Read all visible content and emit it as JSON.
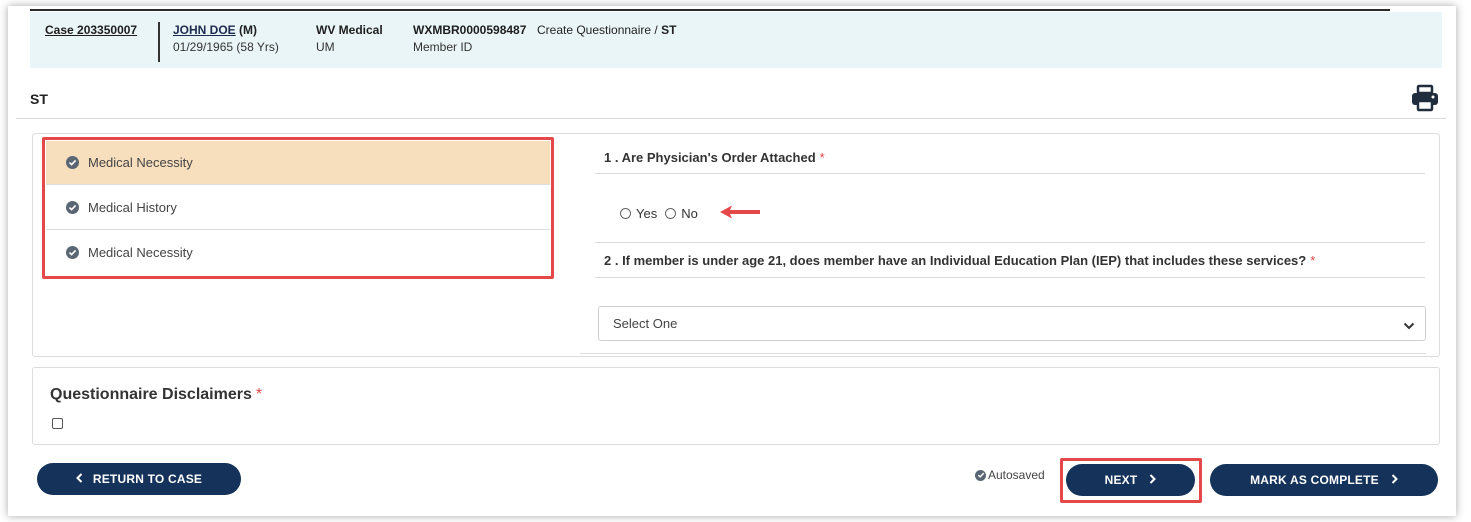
{
  "header": {
    "case_link": "Case 203350007",
    "member_name": "JOHN DOE",
    "member_gender": "(M)",
    "member_dob": "01/29/1965 (58 Yrs)",
    "plan_name": "WV Medical",
    "plan_type": "UM",
    "member_id": "WXMBR0000598487",
    "member_id_label": "Member ID",
    "breadcrumb_prefix": "Create Questionnaire /",
    "breadcrumb_current": "ST"
  },
  "page": {
    "title": "ST",
    "print_icon": "printer-icon"
  },
  "sections": [
    {
      "label": "Medical Necessity",
      "icon": "check-circle-icon",
      "active": true
    },
    {
      "label": "Medical History",
      "icon": "check-circle-icon",
      "active": false
    },
    {
      "label": "Medical Necessity",
      "icon": "check-circle-icon",
      "active": false
    }
  ],
  "questions": {
    "q1": {
      "label": "1 . Are Physician's Order Attached",
      "required_marker": "*",
      "options": [
        "Yes",
        "No"
      ]
    },
    "q2": {
      "label": "2 . If member is under age 21, does member have an Individual Education Plan (IEP) that includes these services?",
      "required_marker": "*",
      "select_value": "Select One"
    }
  },
  "disclaimers": {
    "title": "Questionnaire Disclaimers",
    "required_marker": "*"
  },
  "footer": {
    "return_label": "RETURN TO CASE",
    "autosaved_label": "Autosaved",
    "next_label": "NEXT",
    "complete_label": "MARK AS COMPLETE"
  },
  "colors": {
    "accent_navy": "#14325a",
    "active_row": "#f7dfbd",
    "header_bg": "#eaf5f8",
    "highlight_red": "#e54848",
    "required_red": "#e04646"
  }
}
